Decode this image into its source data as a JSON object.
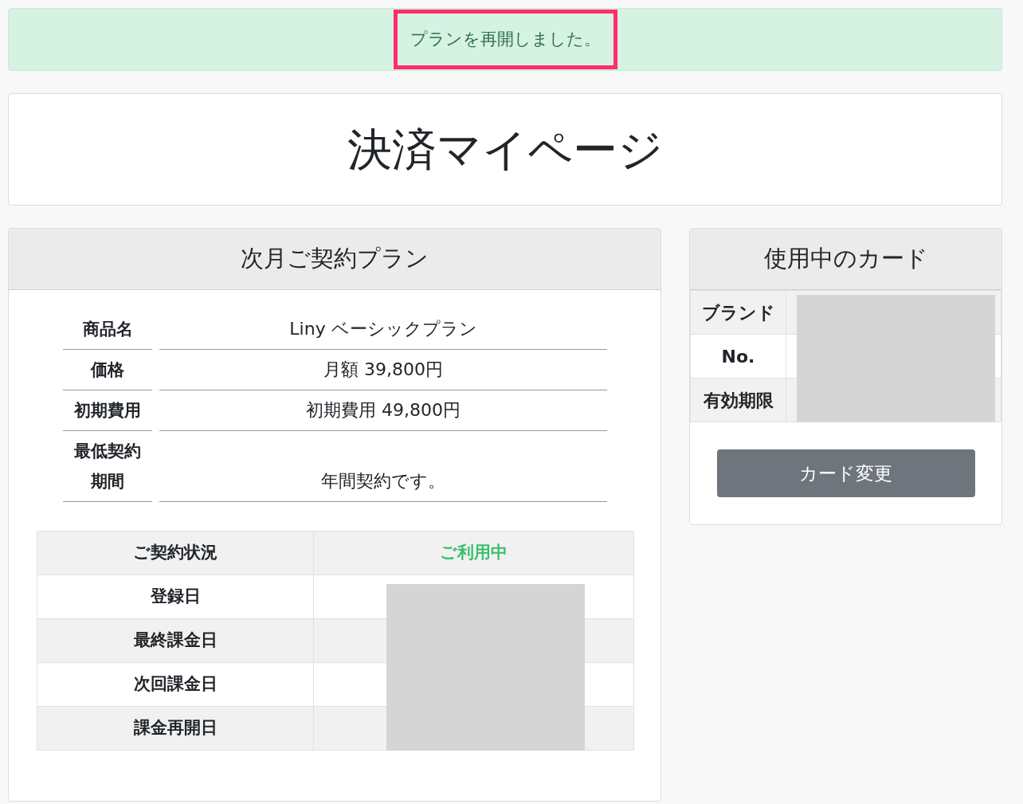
{
  "alert": {
    "message": "プランを再開しました。",
    "highlighted": true
  },
  "page_title": "決済マイページ",
  "plan_card": {
    "title": "次月ご契約プラン",
    "details": [
      {
        "label": "商品名",
        "value": "Liny ベーシックプラン"
      },
      {
        "label": "価格",
        "value": "月額 39,800円"
      },
      {
        "label": "初期費用",
        "value": "初期費用 49,800円"
      },
      {
        "label": "最低契約期間",
        "value": "年間契約です。"
      }
    ],
    "status_table": [
      {
        "label": "ご契約状況",
        "value": "ご利用中"
      },
      {
        "label": "登録日"
      },
      {
        "label": "最終課金日"
      },
      {
        "label": "次回課金日"
      },
      {
        "label": "課金再開日"
      }
    ]
  },
  "card_panel": {
    "title": "使用中のカード",
    "rows": [
      {
        "label": "ブランド"
      },
      {
        "label": "No."
      },
      {
        "label": "有効期限"
      }
    ],
    "button": "カード変更"
  }
}
